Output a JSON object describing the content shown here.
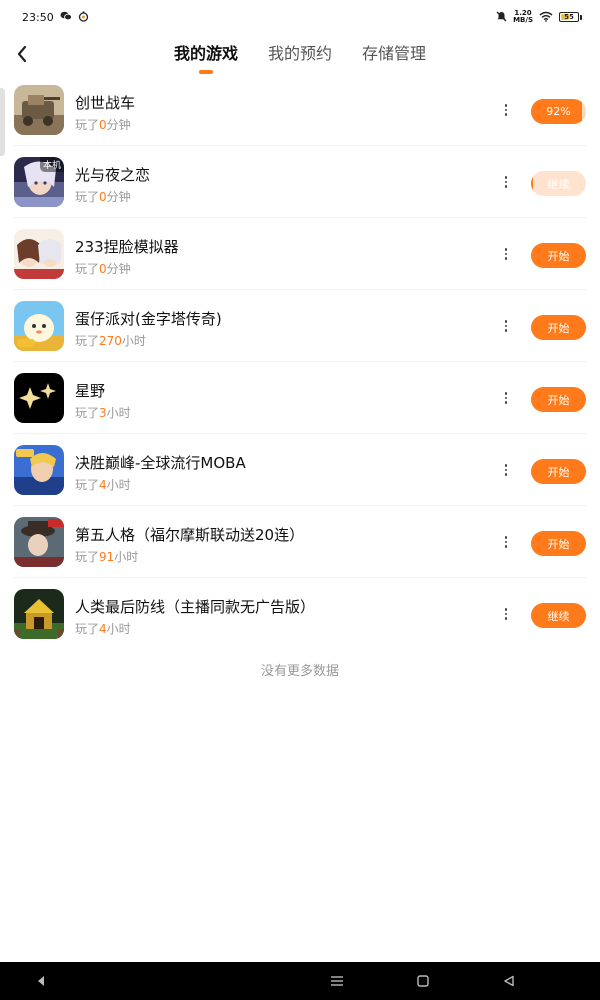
{
  "status_bar": {
    "time": "23:50",
    "net_speed_value": "1.20",
    "net_speed_unit": "MB/S",
    "battery_level": "55"
  },
  "header": {
    "tabs": [
      {
        "label": "我的游戏",
        "active": true
      },
      {
        "label": "我的预约",
        "active": false
      },
      {
        "label": "存储管理",
        "active": false
      }
    ]
  },
  "games": [
    {
      "name": "创世战车",
      "prefix": "玩了",
      "num": "0",
      "unit": "分钟",
      "action": "92%",
      "progress": 0.92
    },
    {
      "name": "光与夜之恋",
      "prefix": "玩了",
      "num": "0",
      "unit": "分钟",
      "action": "继续",
      "tag": "本机",
      "progress": 0.04
    },
    {
      "name": "233捏脸模拟器",
      "prefix": "玩了",
      "num": "0",
      "unit": "分钟",
      "action": "开始"
    },
    {
      "name": "蛋仔派对(金字塔传奇)",
      "prefix": "玩了",
      "num": "270",
      "unit": "小时",
      "action": "开始"
    },
    {
      "name": "星野",
      "prefix": "玩了",
      "num": "3",
      "unit": "小时",
      "action": "开始"
    },
    {
      "name": "决胜巅峰-全球流行MOBA",
      "prefix": "玩了",
      "num": "4",
      "unit": "小时",
      "action": "开始"
    },
    {
      "name": "第五人格（福尔摩斯联动送20连）",
      "prefix": "玩了",
      "num": "91",
      "unit": "小时",
      "action": "开始"
    },
    {
      "name": "人类最后防线（主播同款无广告版）",
      "prefix": "玩了",
      "num": "4",
      "unit": "小时",
      "action": "继续"
    }
  ],
  "footer": {
    "no_more": "没有更多数据"
  },
  "colors": {
    "accent": "#ff7a1a",
    "accent_light": "#ffd7b8"
  }
}
